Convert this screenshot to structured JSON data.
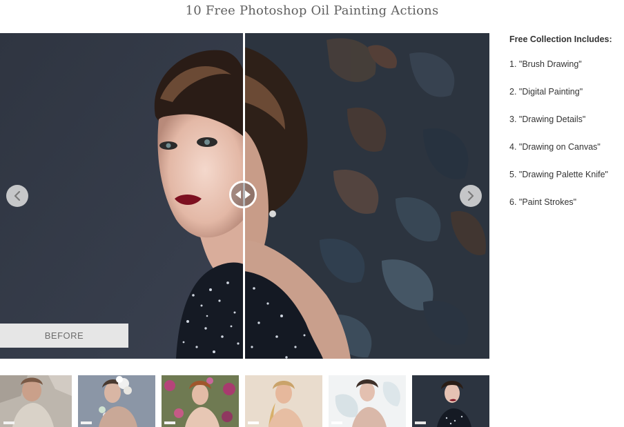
{
  "page": {
    "title": "10 Free Photoshop Oil Painting Actions"
  },
  "viewer": {
    "before_label": "BEFORE",
    "prev_icon": "chevron-left-icon",
    "next_icon": "chevron-right-icon",
    "handle_icon": "left-right-arrows-icon"
  },
  "sidebar": {
    "heading": "Free Collection Includes:",
    "items": [
      "1. \"Brush Drawing\"",
      "2. \"Digital Painting\"",
      "3. \"Drawing Details\"",
      "4. \"Drawing on Canvas\"",
      "5. \"Drawing Palette Knife\"",
      "6. \"Paint Strokes\""
    ]
  },
  "thumbnails": {
    "count": 6
  }
}
